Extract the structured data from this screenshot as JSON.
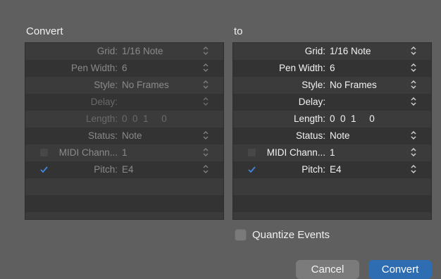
{
  "convert_panel": {
    "title": "Convert",
    "rows": [
      {
        "label": "Grid:",
        "value": "1/16 Note"
      },
      {
        "label": "Pen Width:",
        "value": "6"
      },
      {
        "label": "Style:",
        "value": "No Frames"
      },
      {
        "label": "Delay:",
        "value": ""
      },
      {
        "label": "Length:",
        "value": "0  0  1     0"
      },
      {
        "label": "Status:",
        "value": "Note"
      },
      {
        "label": "MIDI Chann...",
        "value": "1"
      },
      {
        "label": "Pitch:",
        "value": "E4"
      }
    ]
  },
  "to_panel": {
    "title": "to",
    "rows": [
      {
        "label": "Grid:",
        "value": "1/16 Note"
      },
      {
        "label": "Pen Width:",
        "value": "6"
      },
      {
        "label": "Style:",
        "value": "No Frames"
      },
      {
        "label": "Delay:",
        "value": ""
      },
      {
        "label": "Length:",
        "value": "0  0  1     0"
      },
      {
        "label": "Status:",
        "value": "Note"
      },
      {
        "label": "MIDI Chann...",
        "value": "1"
      },
      {
        "label": "Pitch:",
        "value": "E4"
      }
    ]
  },
  "quantize": {
    "label": "Quantize Events"
  },
  "buttons": {
    "cancel": "Cancel",
    "convert": "Convert"
  },
  "colors": {
    "accent": "#2f6db3",
    "checkbox_check": "#3f86e0"
  }
}
